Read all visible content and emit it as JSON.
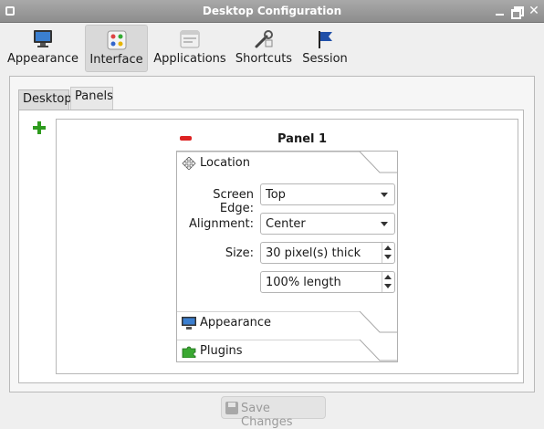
{
  "window": {
    "title": "Desktop Configuration"
  },
  "toolbar": {
    "items": [
      {
        "label": "Appearance",
        "icon": "monitor-icon"
      },
      {
        "label": "Interface",
        "icon": "interface-icon",
        "active": true
      },
      {
        "label": "Applications",
        "icon": "applications-icon"
      },
      {
        "label": "Shortcuts",
        "icon": "shortcuts-icon"
      },
      {
        "label": "Session",
        "icon": "flag-icon"
      }
    ]
  },
  "tabs": [
    {
      "label": "Desktop"
    },
    {
      "label": "Panels",
      "active": true
    }
  ],
  "panel": {
    "title": "Panel 1",
    "sections": {
      "location": "Location",
      "appearance": "Appearance",
      "plugins": "Plugins"
    },
    "fields": {
      "screen_edge": {
        "label": "Screen Edge:",
        "value": "Top"
      },
      "alignment": {
        "label": "Alignment:",
        "value": "Center"
      },
      "size": {
        "label": "Size:",
        "value": "30 pixel(s) thick"
      },
      "length": {
        "value": "100% length"
      }
    }
  },
  "footer": {
    "save_label": "Save Changes"
  },
  "colors": {
    "add": "#2e9b1e",
    "remove": "#dd2222",
    "titlebar": "#9a9a9a"
  }
}
